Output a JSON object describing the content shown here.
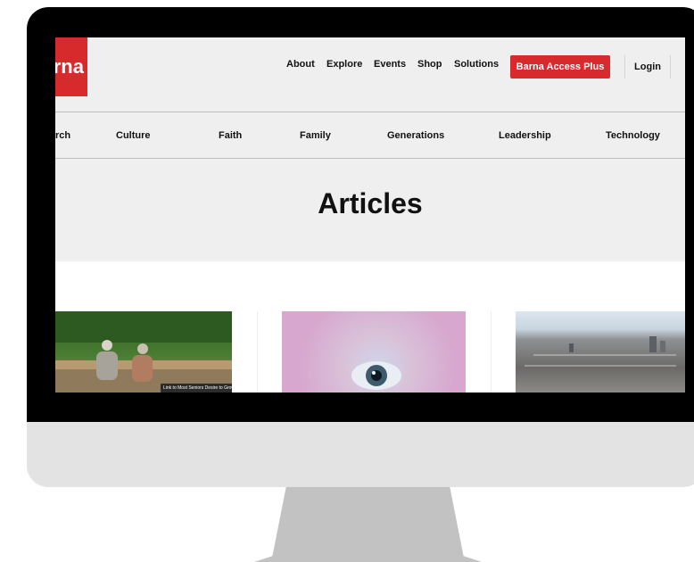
{
  "header": {
    "logo_text": "rna",
    "nav": [
      "About",
      "Explore",
      "Events",
      "Shop",
      "Solutions"
    ],
    "cta_label": "Barna Access Plus",
    "login_label": "Login"
  },
  "categories": [
    "rch",
    "Culture",
    "Faith",
    "Family",
    "Generations",
    "Leadership",
    "Technology"
  ],
  "page_title": "Articles",
  "cards": [
    {
      "tooltip": "Link to Most Seniors Desire to Grow Spiritually"
    }
  ],
  "colors": {
    "brand_red": "#d72a2d",
    "bezel": "#000000",
    "screen_bg": "#efefef",
    "monitor_body": "#e3e3e3",
    "stand": "#c2c2c2"
  }
}
